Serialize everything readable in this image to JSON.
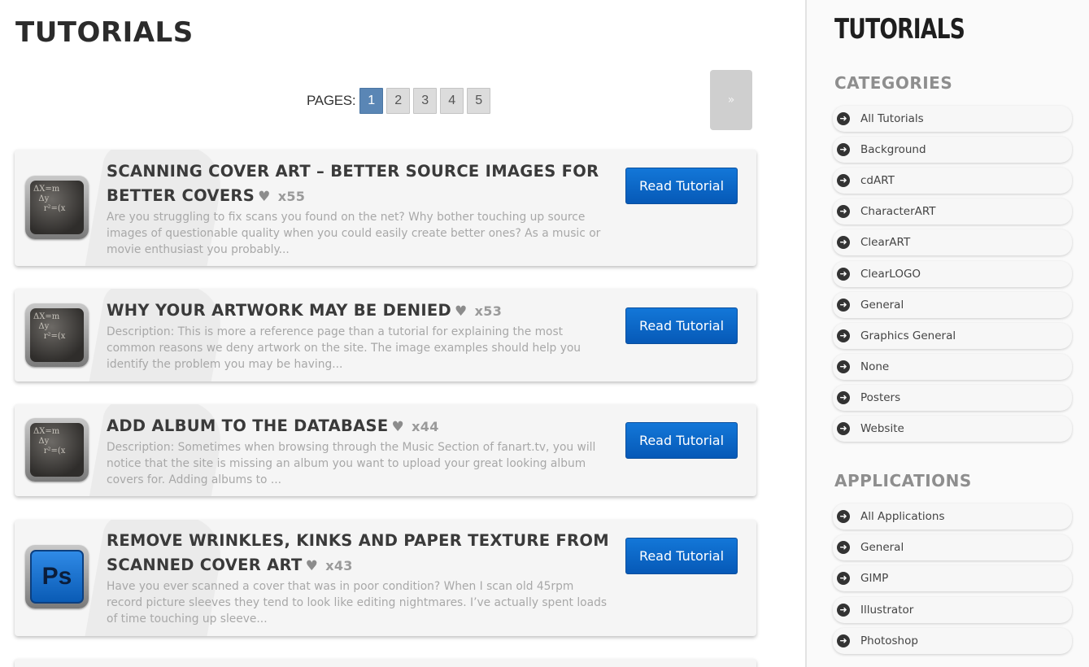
{
  "page": {
    "title": "TUTORIALS",
    "pager_label": "PAGES:",
    "pages": [
      "1",
      "2",
      "3",
      "4",
      "5"
    ],
    "current_page": "1",
    "next_label": "»"
  },
  "tutorials": [
    {
      "title": "SCANNING COVER ART – BETTER SOURCE IMAGES FOR BETTER COVERS",
      "likes": "x55",
      "description": "Are you struggling to fix scans you found on the net? Why bother touching up source images of questionable quality when you could easily create better ones? As a music or movie enthusiast you probably...",
      "button": "Read Tutorial",
      "icon": "math-chalkboard-icon"
    },
    {
      "title": "WHY YOUR ARTWORK MAY BE DENIED",
      "likes": "x53",
      "description": "Description: This is more a reference page than a tutorial for explaining the most common reasons we deny artwork on the site. The image examples should help you identify the problem you may be having...",
      "button": "Read Tutorial",
      "icon": "math-chalkboard-icon"
    },
    {
      "title": "ADD ALBUM TO THE DATABASE",
      "likes": "x44",
      "description": "Description: Sometimes when browsing through the Music Section of fanart.tv, you will notice that the site is missing an album you want to upload your great looking album covers for. Adding albums to ...",
      "button": "Read Tutorial",
      "icon": "math-chalkboard-icon"
    },
    {
      "title": "REMOVE WRINKLES, KINKS AND PAPER TEXTURE FROM SCANNED COVER ART",
      "likes": "x43",
      "description": "Have you ever scanned a cover that was in poor condition? When I scan old 45rpm record picture sleeves they tend to look like editing nightmares. I’ve actually spent loads of time touching up sleeve...",
      "button": "Read Tutorial",
      "icon": "photoshop-icon",
      "icon_text": "Ps"
    }
  ],
  "sidebar": {
    "title": "TUTORIALS",
    "categories_title": "CATEGORIES",
    "categories": [
      "All Tutorials",
      "Background",
      "cdART",
      "CharacterART",
      "ClearART",
      "ClearLOGO",
      "General",
      "Graphics General",
      "None",
      "Posters",
      "Website"
    ],
    "applications_title": "APPLICATIONS",
    "applications": [
      "All Applications",
      "General",
      "GIMP",
      "Illustrator",
      "Photoshop"
    ]
  },
  "colors": {
    "accent_button": "#0659b7",
    "active_page": "#5a86b5"
  }
}
